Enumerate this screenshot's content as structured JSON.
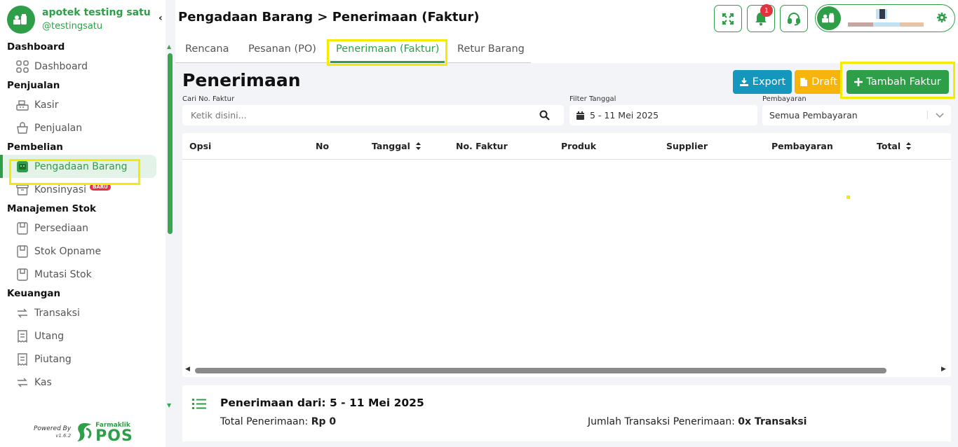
{
  "brand": {
    "name": "apotek testing satu",
    "handle": "@testingsatu"
  },
  "sidebar": {
    "sections": [
      {
        "title": "Dashboard",
        "items": [
          {
            "label": "Dashboard",
            "icon": "grid-icon"
          }
        ]
      },
      {
        "title": "Penjualan",
        "items": [
          {
            "label": "Kasir",
            "icon": "cash-register-icon"
          },
          {
            "label": "Penjualan",
            "icon": "basket-icon"
          }
        ]
      },
      {
        "title": "Pembelian",
        "items": [
          {
            "label": "Pengadaan Barang",
            "icon": "procurement-icon",
            "active": true
          },
          {
            "label": "Konsinyasi",
            "icon": "archive-box-icon",
            "badge": "BARU"
          }
        ]
      },
      {
        "title": "Manajemen Stok",
        "items": [
          {
            "label": "Persediaan",
            "icon": "stock-box-icon"
          },
          {
            "label": "Stok Opname",
            "icon": "stock-box-icon"
          },
          {
            "label": "Mutasi Stok",
            "icon": "stock-box-icon"
          }
        ]
      },
      {
        "title": "Keuangan",
        "items": [
          {
            "label": "Transaksi",
            "icon": "transfer-arrows-icon"
          },
          {
            "label": "Utang",
            "icon": "receipt-icon"
          },
          {
            "label": "Piutang",
            "icon": "receipt-icon"
          },
          {
            "label": "Kas",
            "icon": "transfer-arrows-icon"
          }
        ]
      }
    ],
    "powered_by": "Powered By",
    "version": "v1.6.2",
    "logo_small": "Farmaklik",
    "logo_big": "POS"
  },
  "header": {
    "title": "Pengadaan Barang > Penerimaan (Faktur)",
    "notification_count": "1"
  },
  "tabs": [
    {
      "label": "Rencana"
    },
    {
      "label": "Pesanan (PO)"
    },
    {
      "label": "Penerimaan (Faktur)",
      "active": true
    },
    {
      "label": "Retur Barang"
    }
  ],
  "main": {
    "title": "Penerimaan",
    "export_label": "Export",
    "draft_label": "Draft",
    "add_label": "Tambah Faktur"
  },
  "filters": {
    "search_label": "Cari No. Faktur",
    "search_placeholder": "Ketik disini...",
    "date_label": "Filter Tanggal",
    "date_value": "5 - 11 Mei 2025",
    "payment_label": "Pembayaran",
    "payment_value": "Semua Pembayaran"
  },
  "table": {
    "columns": [
      "Opsi",
      "No",
      "Tanggal",
      "No. Faktur",
      "Produk",
      "Supplier",
      "Pembayaran",
      "Total"
    ],
    "rows": []
  },
  "summary": {
    "title": "Penerimaan dari: 5 - 11 Mei 2025",
    "total_label": "Total Penerimaan:",
    "total_value": "Rp 0",
    "count_label": "Jumlah Transaksi Penerimaan:",
    "count_value": "0x Transaksi"
  },
  "colors": {
    "brand_green": "#2e9e48",
    "export_blue": "#1496bd",
    "draft_yellow": "#f6b40c",
    "badge_red": "#e0353e",
    "highlight": "#f4ec00"
  }
}
